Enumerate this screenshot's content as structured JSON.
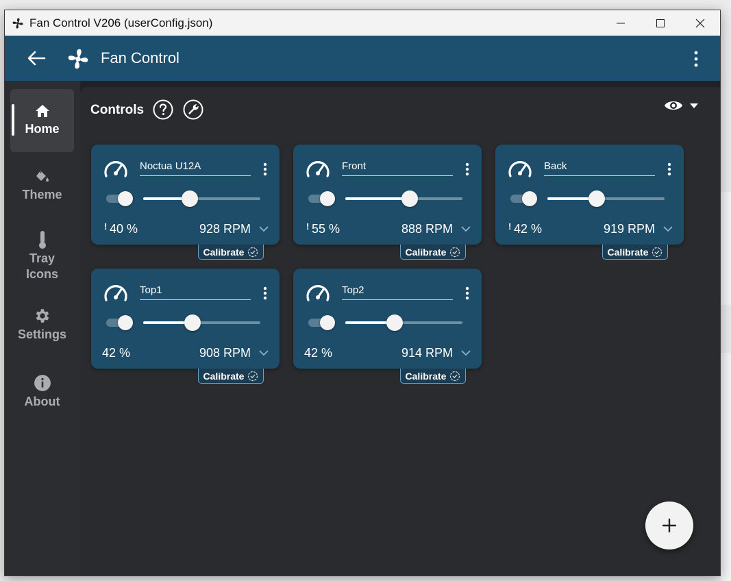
{
  "window": {
    "title": "Fan Control V206 (userConfig.json)"
  },
  "appbar": {
    "title": "Fan Control"
  },
  "sidebar": {
    "items": [
      {
        "label": "Home",
        "icon": "home-icon",
        "active": true
      },
      {
        "label": "Theme",
        "icon": "paint-bucket-icon",
        "active": false
      },
      {
        "label": "Tray Icons",
        "icon": "thermometer-icon",
        "active": false
      },
      {
        "label": "Settings",
        "icon": "gear-icon",
        "active": false
      },
      {
        "label": "About",
        "icon": "info-icon",
        "active": false
      }
    ]
  },
  "section": {
    "title": "Controls"
  },
  "controls": [
    {
      "name": "Noctua U12A",
      "warning": "!",
      "percent": "40 %",
      "rpm": "928 RPM",
      "level": 0.4,
      "calibrate": "Calibrate"
    },
    {
      "name": "Front",
      "warning": "!",
      "percent": "55 %",
      "rpm": "888 RPM",
      "level": 0.55,
      "calibrate": "Calibrate"
    },
    {
      "name": "Back",
      "warning": "!",
      "percent": "42 %",
      "rpm": "919 RPM",
      "level": 0.42,
      "calibrate": "Calibrate"
    },
    {
      "name": "Top1",
      "warning": "",
      "percent": "42 %",
      "rpm": "908 RPM",
      "level": 0.42,
      "calibrate": "Calibrate"
    },
    {
      "name": "Top2",
      "warning": "",
      "percent": "42 %",
      "rpm": "914 RPM",
      "level": 0.42,
      "calibrate": "Calibrate"
    }
  ],
  "colors": {
    "accent": "#1d4f6e",
    "card": "#1e4d6a",
    "background": "#2a2b2e"
  },
  "fab": {
    "icon": "plus-icon"
  }
}
